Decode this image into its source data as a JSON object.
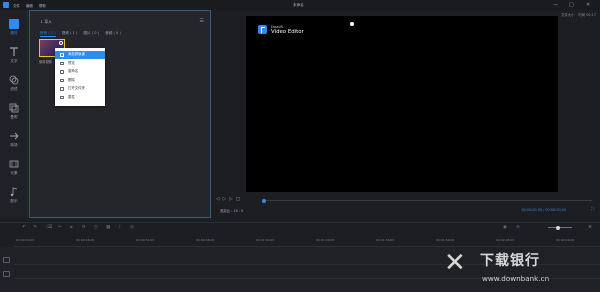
{
  "titlebar": {
    "menus": [
      "文件",
      "编辑",
      "帮助"
    ],
    "title": "未命名"
  },
  "sidebar": {
    "items": [
      {
        "label": "素材",
        "icon": "media-icon"
      },
      {
        "label": "文字",
        "icon": "text-icon"
      },
      {
        "label": "滤镜",
        "icon": "filter-icon"
      },
      {
        "label": "叠附",
        "icon": "overlay-icon"
      },
      {
        "label": "转场",
        "icon": "transition-icon"
      },
      {
        "label": "元素",
        "icon": "element-icon"
      },
      {
        "label": "配乐",
        "icon": "music-icon"
      }
    ]
  },
  "media": {
    "import_label": "导入",
    "tabs": [
      "所有 ( 1 )",
      "视频 ( 1 )",
      "图片 ( 0 )",
      "音频 ( 0 )"
    ],
    "thumb_caption": "使用视频"
  },
  "context_menu": {
    "items": [
      {
        "label": "添加到轨道",
        "highlighted": true
      },
      {
        "label": "预览"
      },
      {
        "label": "重命名"
      },
      {
        "label": "删除"
      },
      {
        "label": "打开文件夹"
      },
      {
        "label": "属性"
      }
    ]
  },
  "preview": {
    "info": "文件大小   时间 00:17",
    "brand_small": "EaseUS",
    "brand_big": "Video Editor",
    "ratio": "宽高比 : 16 : 9",
    "time": "00:00:00.00 / 00:00:00.00"
  },
  "timeline": {
    "ticks": [
      "00:00:00.00",
      "00:00:16.00",
      "00:00:32.00",
      "00:00:48.00",
      "00:01:04.00",
      "00:01:20.00",
      "00:01:36.00",
      "00:01:52.00",
      "00:02:08.00",
      "00:02:24.00"
    ]
  },
  "watermark": {
    "logo": "✕",
    "text": "下载银行",
    "url": "www.downbank.cn"
  },
  "colors": {
    "accent": "#2d8cf0",
    "highlight": "#f0c419"
  }
}
